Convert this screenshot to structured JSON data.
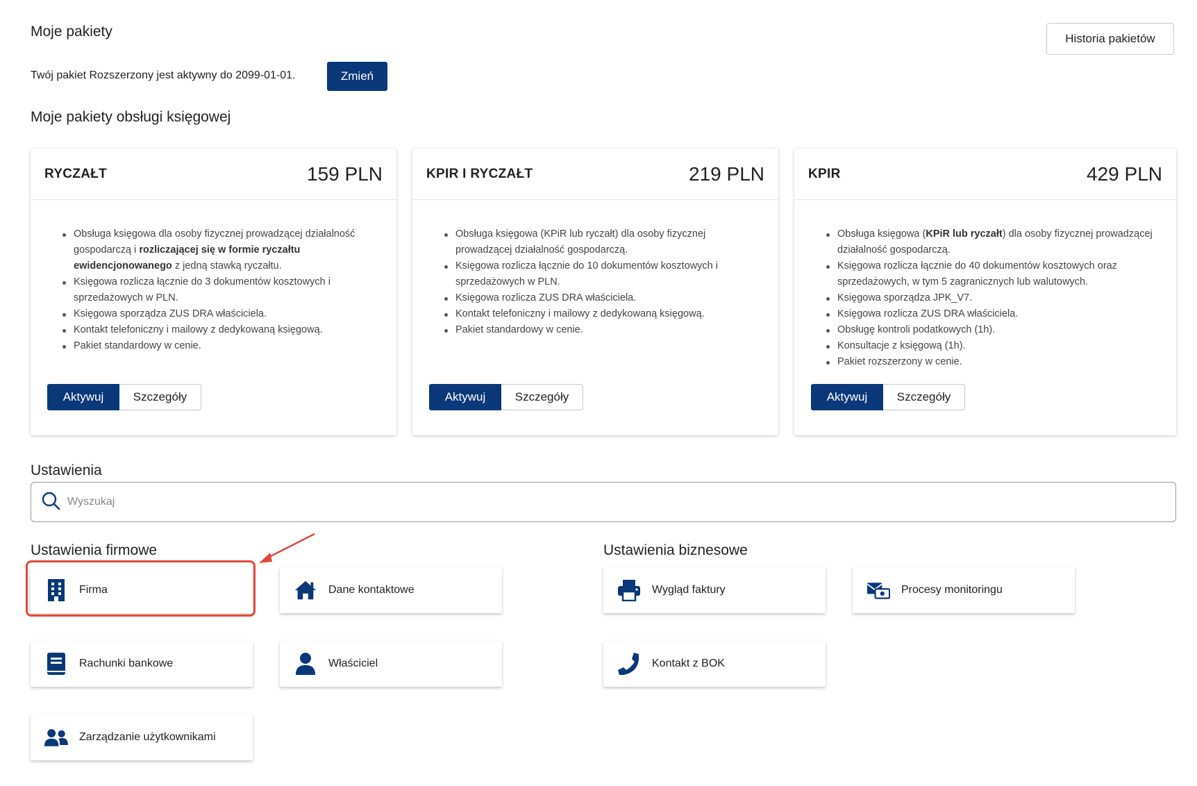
{
  "header": {
    "title": "Moje pakiety",
    "history_button": "Historia pakietów"
  },
  "status": {
    "text": "Twój pakiet Rozszerzony jest aktywny do 2099-01-01.",
    "change_button": "Zmień"
  },
  "accounting": {
    "title": "Moje pakiety obsługi księgowej",
    "cards": [
      {
        "name": "RYCZAŁT",
        "price": "159 PLN",
        "items": [
          [
            "Obsługa księgowa dla osoby fizycznej prowadzącej działalność gospodarczą i ",
            "rozliczającej się w formie ryczałtu ewidencjonowanego",
            " z jedną stawką ryczałtu."
          ],
          [
            "Księgowa rozlicza łącznie do 3 dokumentów kosztowych i sprzedażowych w PLN.",
            "",
            ""
          ],
          [
            "Księgowa sporządza ZUS DRA właściciela.",
            "",
            ""
          ],
          [
            "Kontakt telefoniczny i mailowy z dedykowaną księgową.",
            "",
            ""
          ],
          [
            "Pakiet standardowy w cenie.",
            "",
            ""
          ]
        ],
        "activate": "Aktywuj",
        "details": "Szczegóły"
      },
      {
        "name": "KPIR I RYCZAŁT",
        "price": "219 PLN",
        "items": [
          [
            "Obsługa księgowa (KPiR lub ryczałt) dla osoby fizycznej prowadzącej działalność gospodarczą.",
            "",
            ""
          ],
          [
            "Księgowa rozlicza łącznie do 10 dokumentów kosztowych i sprzedażowych w PLN.",
            "",
            ""
          ],
          [
            "Księgowa rozlicza ZUS DRA właściciela.",
            "",
            ""
          ],
          [
            "Kontakt telefoniczny i mailowy z dedykowaną księgową.",
            "",
            ""
          ],
          [
            "Pakiet standardowy w cenie.",
            "",
            ""
          ]
        ],
        "activate": "Aktywuj",
        "details": "Szczegóły"
      },
      {
        "name": "KPIR",
        "price": "429 PLN",
        "items": [
          [
            "Obsługa księgowa (",
            "KPiR lub ryczałt",
            ") dla osoby fizycznej prowadzącej działalność gospodarczą."
          ],
          [
            "Księgowa rozlicza łącznie do 40 dokumentów kosztowych oraz sprzedażowych, w tym 5 zagranicznych lub walutowych.",
            "",
            ""
          ],
          [
            "Księgowa sporządza JPK_V7.",
            "",
            ""
          ],
          [
            "Księgowa rozlicza ZUS DRA właściciela.",
            "",
            ""
          ],
          [
            "Obsługę kontroli podatkowych (1h).",
            "",
            ""
          ],
          [
            "Konsultacje z księgową (1h).",
            "",
            ""
          ],
          [
            "Pakiet rozszerzony w cenie.",
            "",
            ""
          ]
        ],
        "activate": "Aktywuj",
        "details": "Szczegóły"
      }
    ]
  },
  "settings": {
    "title": "Ustawienia",
    "search_placeholder": "Wyszukaj",
    "company_title": "Ustawienia firmowe",
    "business_title": "Ustawienia biznesowe",
    "company_tiles": [
      {
        "label": "Firma",
        "icon": "building-icon"
      },
      {
        "label": "Dane kontaktowe",
        "icon": "home-icon"
      },
      {
        "label": "Rachunki bankowe",
        "icon": "book-icon"
      },
      {
        "label": "Właściciel",
        "icon": "user-icon"
      },
      {
        "label": "Zarządzanie użytkownikami",
        "icon": "users-icon"
      }
    ],
    "business_tiles": [
      {
        "label": "Wygląd faktury",
        "icon": "printer-icon"
      },
      {
        "label": "Procesy monitoringu",
        "icon": "envelope-money-icon"
      },
      {
        "label": "Kontakt z BOK",
        "icon": "phone-icon"
      }
    ]
  },
  "colors": {
    "primary": "#0a3878",
    "highlight": "#e0483a"
  }
}
